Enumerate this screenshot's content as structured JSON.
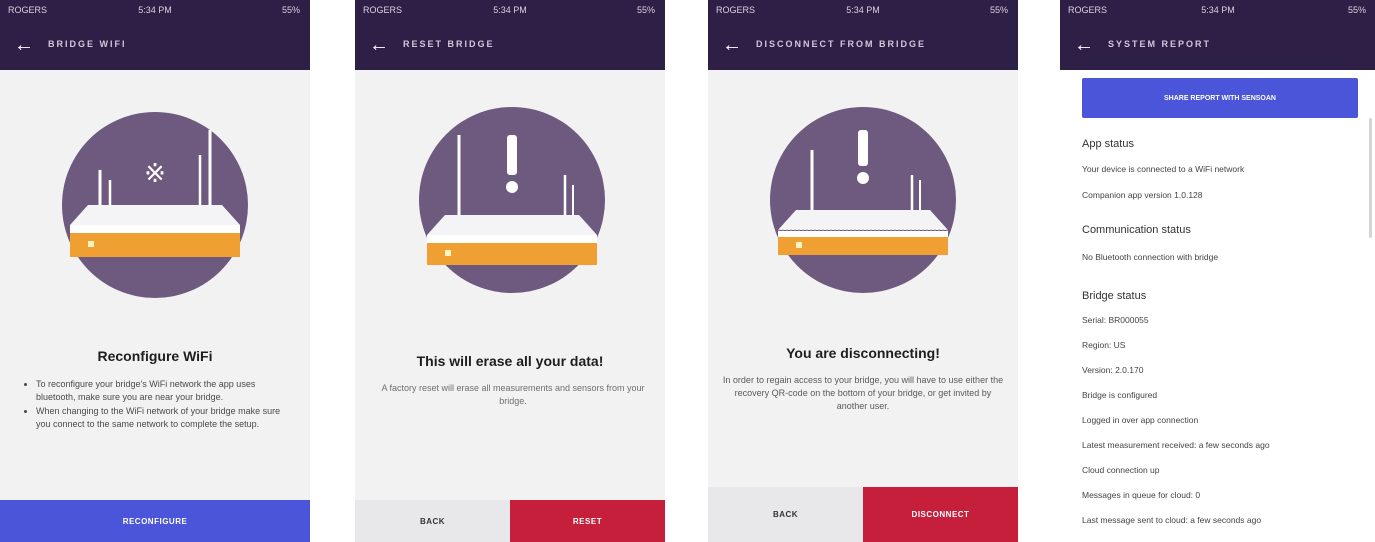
{
  "status_bar": {
    "carrier": "ROGERS",
    "time": "5:34 PM",
    "battery": "55%"
  },
  "screens": [
    {
      "title": "BRIDGE WIFI",
      "heading": "Reconfigure WiFi",
      "bullets": [
        "To reconfigure your bridge's WiFi network the app uses bluetooth, make sure you are near your bridge.",
        "When changing to the WiFi network of your bridge make sure you connect to the same network to complete the setup."
      ],
      "button": "RECONFIGURE"
    },
    {
      "title": "RESET BRIDGE",
      "heading": "This will erase all your data!",
      "body": "A factory reset will erase all measurements and sensors from your bridge.",
      "back_label": "BACK",
      "action_label": "RESET"
    },
    {
      "title": "DISCONNECT FROM BRIDGE",
      "heading": "You are disconnecting!",
      "body": "In order to regain access to your bridge, you will have to use either the recovery QR-code on the bottom of your bridge, or get invited by another user.",
      "back_label": "BACK",
      "action_label": "DISCONNECT"
    },
    {
      "title": "SYSTEM REPORT",
      "share_label": "SHARE REPORT WITH SENSOAN",
      "app_status_heading": "App status",
      "app_status": [
        "Your device is connected to a WiFi network",
        "Companion app version 1.0.128"
      ],
      "comm_status_heading": "Communication status",
      "comm_status": [
        "No Bluetooth connection with bridge"
      ],
      "bridge_status_heading": "Bridge status",
      "bridge_status": [
        "Serial: BR000055",
        "Region: US",
        "Version: 2.0.170",
        "Bridge is configured",
        "Logged in over app connection",
        "Latest measurement received: a few seconds ago",
        "Cloud connection up",
        "Messages in queue for cloud: 0",
        "Last message sent to cloud: a few seconds ago"
      ]
    }
  ],
  "colors": {
    "header": "#2d1f45",
    "accent_blue": "#4a55d9",
    "danger_red": "#c51f3b",
    "circle": "#6e5a7e",
    "bridge_orange": "#f0a033"
  }
}
